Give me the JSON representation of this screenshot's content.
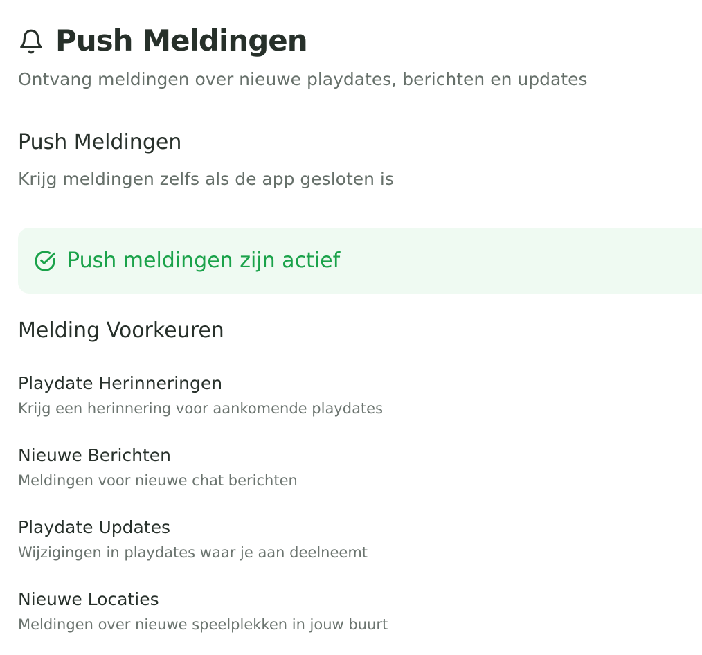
{
  "header": {
    "title": "Push Meldingen",
    "subtitle": "Ontvang meldingen over nieuwe playdates, berichten en updates",
    "icon": "bell-icon"
  },
  "push_section": {
    "heading": "Push Meldingen",
    "description": "Krijg meldingen zelfs als de app gesloten is"
  },
  "status": {
    "text": "Push meldingen zijn actief",
    "icon": "check-circle-icon",
    "color": "#1aa24a",
    "background": "#effaf2"
  },
  "preferences": {
    "heading": "Melding Voorkeuren",
    "items": [
      {
        "title": "Playdate Herinneringen",
        "description": "Krijg een herinnering voor aankomende playdates"
      },
      {
        "title": "Nieuwe Berichten",
        "description": "Meldingen voor nieuwe chat berichten"
      },
      {
        "title": "Playdate Updates",
        "description": "Wijzigingen in playdates waar je aan deelneemt"
      },
      {
        "title": "Nieuwe Locaties",
        "description": "Meldingen over nieuwe speelplekken in jouw buurt"
      }
    ]
  }
}
